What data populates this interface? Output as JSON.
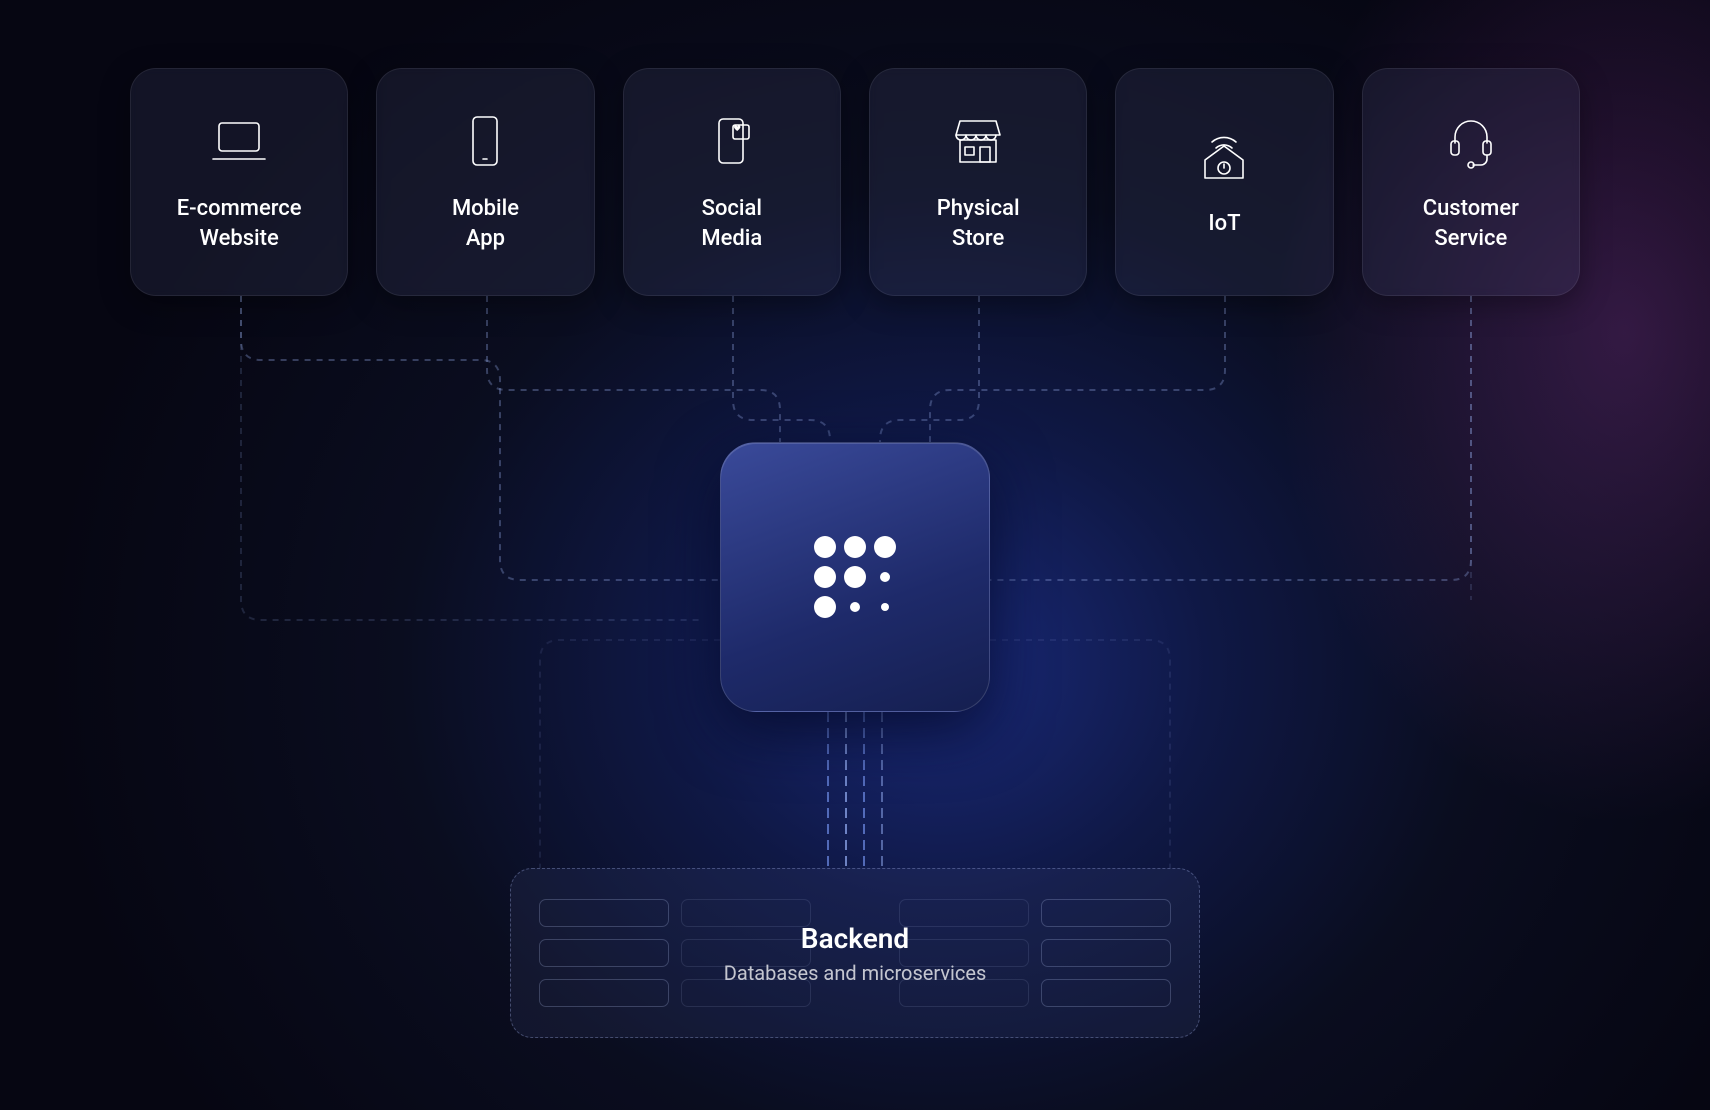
{
  "channels": [
    {
      "id": "ecommerce",
      "label": "E-commerce\nWebsite",
      "icon": "laptop-icon"
    },
    {
      "id": "mobile",
      "label": "Mobile\nApp",
      "icon": "mobile-icon"
    },
    {
      "id": "social",
      "label": "Social\nMedia",
      "icon": "social-icon"
    },
    {
      "id": "store",
      "label": "Physical\nStore",
      "icon": "store-icon"
    },
    {
      "id": "iot",
      "label": "IoT",
      "icon": "iot-icon"
    },
    {
      "id": "customer",
      "label": "Customer\nService",
      "icon": "headset-icon"
    }
  ],
  "hub": {
    "icon": "grid-dots-icon"
  },
  "backend": {
    "title": "Backend",
    "subtitle": "Databases and microservices"
  },
  "colors": {
    "bg_deep": "#060612",
    "bg_blue": "#1a2a7a",
    "bg_magenta": "#823290",
    "card_bg": "rgba(70,75,110,0.22)",
    "line": "rgba(140,160,220,0.35)"
  }
}
